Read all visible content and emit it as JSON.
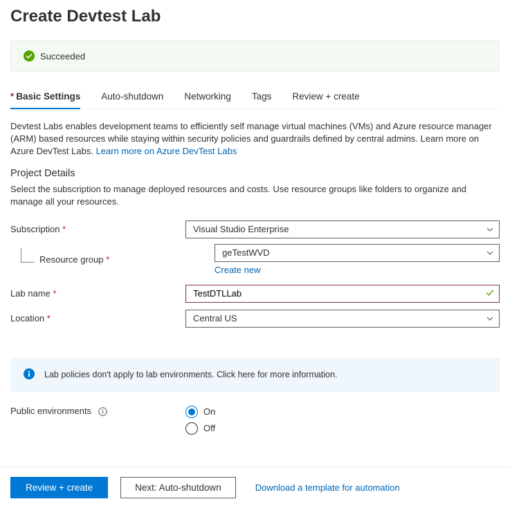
{
  "title": "Create Devtest Lab",
  "success_banner": {
    "text": "Succeeded"
  },
  "tabs": [
    {
      "label": "Basic Settings",
      "required": true,
      "active": true
    },
    {
      "label": "Auto-shutdown"
    },
    {
      "label": "Networking"
    },
    {
      "label": "Tags"
    },
    {
      "label": "Review + create"
    }
  ],
  "intro": {
    "text": "Devtest Labs enables development teams to efficiently self manage virtual machines (VMs) and Azure resource manager (ARM) based resources while staying within security policies and guardrails defined by central admins. Learn more on Azure DevTest Labs. ",
    "link": "Learn more on Azure DevTest Labs"
  },
  "project": {
    "heading": "Project Details",
    "desc": "Select the subscription to manage deployed resources and costs. Use resource groups like folders to organize and manage all your resources."
  },
  "form": {
    "subscription": {
      "label": "Subscription",
      "value": "Visual Studio Enterprise"
    },
    "resource_group": {
      "label": "Resource group",
      "value": "geTestWVD",
      "create_new": "Create new"
    },
    "lab_name": {
      "label": "Lab name",
      "value": "TestDTLLab"
    },
    "location": {
      "label": "Location",
      "value": "Central US"
    }
  },
  "info_banner": "Lab policies don't apply to lab environments.  Click here for more information.",
  "public_env": {
    "label": "Public environments",
    "on": "On",
    "off": "Off"
  },
  "footer": {
    "primary": "Review + create",
    "secondary": "Next: Auto-shutdown",
    "download": "Download a template for automation"
  }
}
